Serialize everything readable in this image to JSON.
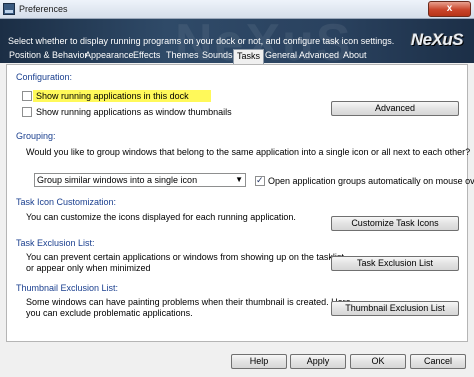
{
  "window": {
    "title": "Preferences",
    "close_glyph": "x"
  },
  "banner": {
    "text": "Select whether to display running programs on your dock or not, and configure task icon settings.",
    "watermark": "NeXuS",
    "logo": "NeXuS"
  },
  "tabs": [
    {
      "label": "Position & Behavior",
      "active": false
    },
    {
      "label": "Appearance",
      "active": false
    },
    {
      "label": "Effects",
      "active": false
    },
    {
      "label": "Themes",
      "active": false
    },
    {
      "label": "Sounds",
      "active": false
    },
    {
      "label": "Tasks",
      "active": true
    },
    {
      "label": "General",
      "active": false
    },
    {
      "label": "Advanced",
      "active": false
    },
    {
      "label": "About",
      "active": false
    }
  ],
  "configuration": {
    "title": "Configuration:",
    "show_running": {
      "label": "Show running applications in this dock",
      "checked": false,
      "highlight_color": "#fff95a"
    },
    "show_thumbnails": {
      "label": "Show running applications as window thumbnails",
      "checked": false
    },
    "advanced_button": "Advanced"
  },
  "grouping": {
    "title": "Grouping:",
    "description": "Would you like to group windows that belong to the same application into a single icon or all next to each other?",
    "select_value": "Group similar windows into a single icon",
    "open_groups": {
      "label": "Open application groups automatically on mouse over",
      "checked": true
    }
  },
  "task_icon": {
    "title": "Task Icon Customization:",
    "description": "You can customize the icons displayed for each running application.",
    "button": "Customize Task Icons"
  },
  "task_exclusion": {
    "title": "Task Exclusion List:",
    "description_line1": "You can prevent certain applications or windows from showing up on the tasklist",
    "description_line2": "or appear only when minimized",
    "button": "Task Exclusion List"
  },
  "thumbnail_exclusion": {
    "title": "Thumbnail Exclusion List:",
    "description_line1": "Some windows can have painting problems when their thumbnail is created. Here",
    "description_line2": "you can exclude problematic applications.",
    "button": "Thumbnail Exclusion List"
  },
  "footer": {
    "help": "Help",
    "apply": "Apply",
    "ok": "OK",
    "cancel": "Cancel"
  },
  "colors": {
    "section_title": "#1a3f8f",
    "banner": "#2f4a68"
  }
}
